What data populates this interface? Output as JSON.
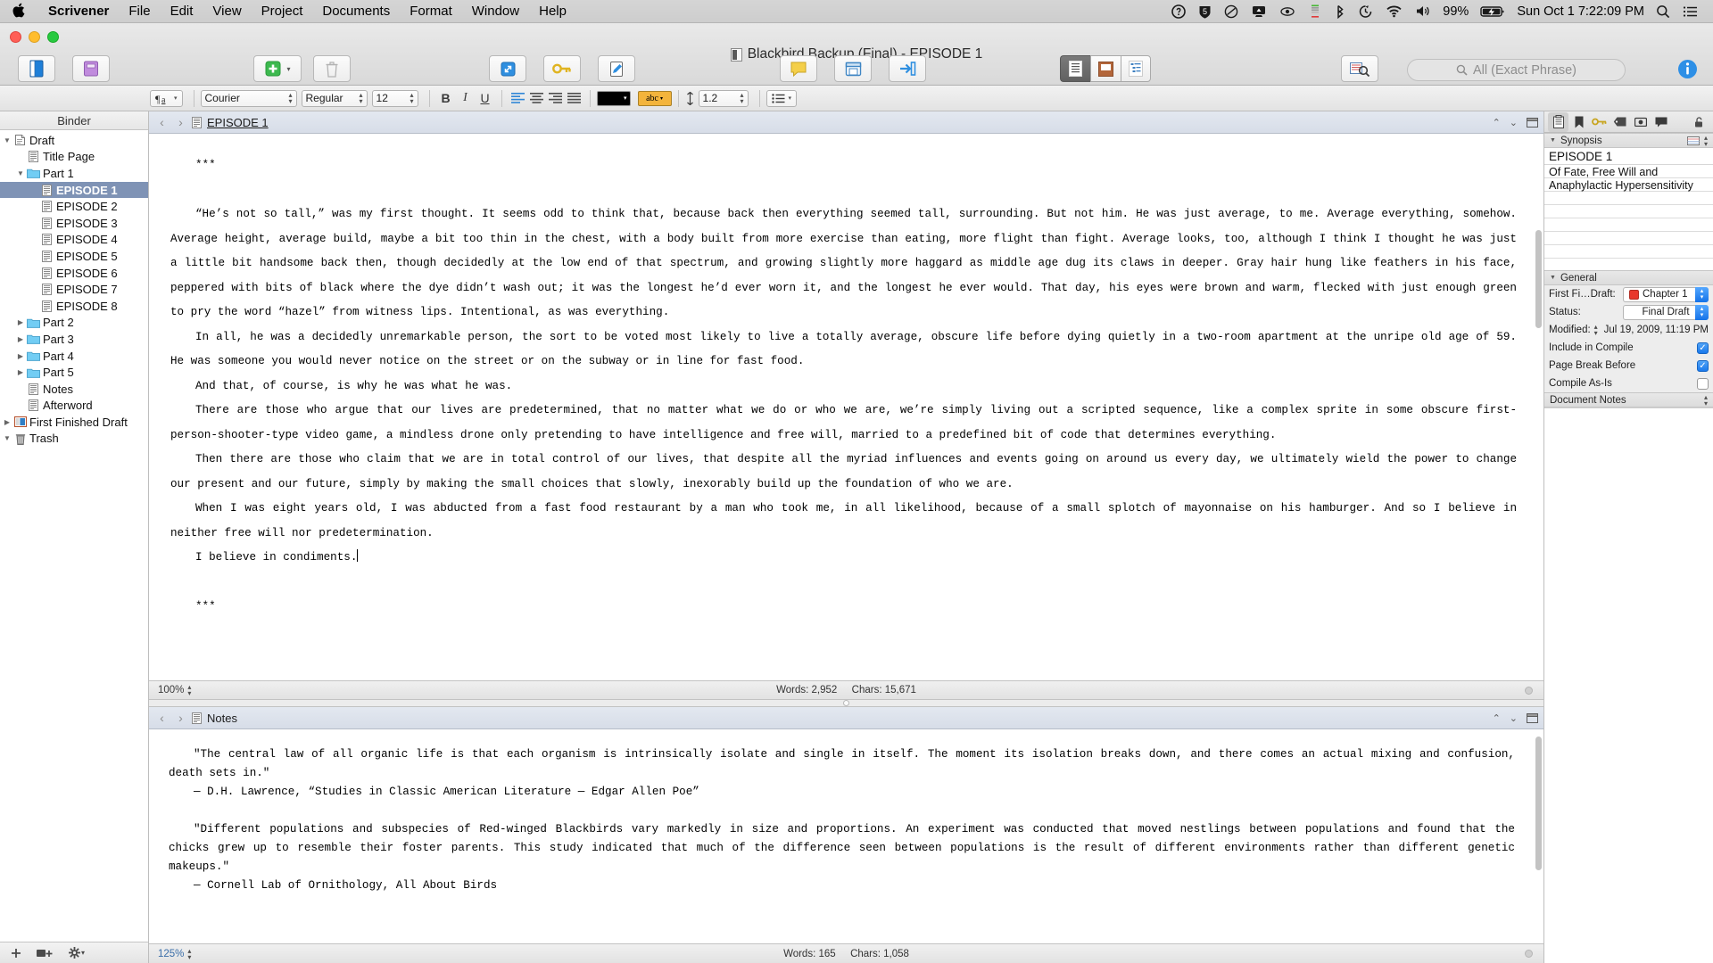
{
  "menubar": {
    "apple_icon": "apple-icon",
    "items": [
      {
        "label": "Scrivener",
        "bold": true
      },
      {
        "label": "File",
        "bold": false
      },
      {
        "label": "Edit",
        "bold": false
      },
      {
        "label": "View",
        "bold": false
      },
      {
        "label": "Project",
        "bold": false
      },
      {
        "label": "Documents",
        "bold": false
      },
      {
        "label": "Format",
        "bold": false
      },
      {
        "label": "Window",
        "bold": false
      },
      {
        "label": "Help",
        "bold": false
      }
    ],
    "status_icons": [
      "one-password-icon",
      "shield-icon",
      "crashplan-icon",
      "display-menu-icon",
      "eye-icon",
      "istat-menu-icon",
      "bluetooth-icon",
      "time-machine-icon",
      "wifi-icon",
      "volume-icon"
    ],
    "battery_percent": "99%",
    "battery_icon": "battery-charging-icon",
    "clock": "Sun Oct 1  7:22:09 PM",
    "search_icon": "spotlight-search-icon",
    "notification_icon": "notification-center-icon"
  },
  "window": {
    "title": "Blackbird Backup (Final) - EPISODE 1",
    "title_icon": "document-icon"
  },
  "toolbar": {
    "left_group": [
      {
        "label": "Binder",
        "icon": "binder-icon",
        "disabled": false
      },
      {
        "label": "Collections",
        "icon": "collections-icon",
        "disabled": false
      }
    ],
    "add_group": [
      {
        "label": "Add",
        "icon": "add-plus-icon",
        "disabled": false
      },
      {
        "label": "Trash",
        "icon": "trash-icon",
        "disabled": true
      }
    ],
    "tools_group": [
      {
        "label": "Compose",
        "icon": "compose-fullscreen-icon",
        "disabled": false
      },
      {
        "label": "Keywords",
        "icon": "keywords-key-icon",
        "disabled": false
      },
      {
        "label": "QuickRef",
        "icon": "quickref-pencil-icon",
        "disabled": false
      }
    ],
    "comment_group": [
      {
        "label": "Comment",
        "icon": "comment-bubble-icon",
        "disabled": false
      },
      {
        "label": "Wrap",
        "icon": "wrap-window-icon",
        "disabled": false
      },
      {
        "label": "Compile",
        "icon": "compile-arrow-icon",
        "disabled": false
      }
    ],
    "view_mode": {
      "label": "View Mode",
      "options": [
        "document-view-icon",
        "corkboard-view-icon",
        "outliner-view-icon"
      ],
      "selected_index": 0
    },
    "find_synopsis": {
      "label": "Find Synopsis",
      "icon": "find-synopsis-icon"
    },
    "search": {
      "label": "Search",
      "placeholder": "All (Exact Phrase)",
      "icon": "search-icon",
      "value": ""
    },
    "inspector": {
      "label": "Inspector",
      "icon": "info-circle-icon"
    }
  },
  "formatbar": {
    "paragraph_icon": "paragraph-style-icon",
    "font_family": "Courier",
    "font_style": "Regular",
    "font_size": "12",
    "bold": "B",
    "italic": "I",
    "underline": "U",
    "align_icons": [
      "align-left-icon",
      "align-center-icon",
      "align-right-icon",
      "align-justify-icon"
    ],
    "align_selected": 0,
    "text_color": "#000000",
    "highlight_color": "#f3b43c",
    "highlight_label": "abc",
    "line_spacing_icon": "line-spacing-icon",
    "line_spacing": "1.2",
    "list_icon": "list-icon"
  },
  "binder": {
    "header": "Binder",
    "items": [
      {
        "label": "Draft",
        "indent": 0,
        "icon": "draft-stack-icon",
        "disclosure": "down",
        "selected": false
      },
      {
        "label": "Title Page",
        "indent": 1,
        "icon": "text-doc-icon",
        "disclosure": "none",
        "selected": false
      },
      {
        "label": "Part 1",
        "indent": 1,
        "icon": "folder-icon",
        "disclosure": "down",
        "selected": false
      },
      {
        "label": "EPISODE 1",
        "indent": 2,
        "icon": "text-doc-icon",
        "disclosure": "none",
        "selected": true
      },
      {
        "label": "EPISODE 2",
        "indent": 2,
        "icon": "text-doc-icon",
        "disclosure": "none",
        "selected": false
      },
      {
        "label": "EPISODE 3",
        "indent": 2,
        "icon": "text-doc-icon",
        "disclosure": "none",
        "selected": false
      },
      {
        "label": "EPISODE 4",
        "indent": 2,
        "icon": "text-doc-icon",
        "disclosure": "none",
        "selected": false
      },
      {
        "label": "EPISODE 5",
        "indent": 2,
        "icon": "text-doc-icon",
        "disclosure": "none",
        "selected": false
      },
      {
        "label": "EPISODE 6",
        "indent": 2,
        "icon": "text-doc-icon",
        "disclosure": "none",
        "selected": false
      },
      {
        "label": "EPISODE 7",
        "indent": 2,
        "icon": "text-doc-icon",
        "disclosure": "none",
        "selected": false
      },
      {
        "label": "EPISODE 8",
        "indent": 2,
        "icon": "text-doc-icon",
        "disclosure": "none",
        "selected": false
      },
      {
        "label": "Part 2",
        "indent": 1,
        "icon": "folder-icon",
        "disclosure": "right",
        "selected": false
      },
      {
        "label": "Part 3",
        "indent": 1,
        "icon": "folder-icon",
        "disclosure": "right",
        "selected": false
      },
      {
        "label": "Part 4",
        "indent": 1,
        "icon": "folder-icon",
        "disclosure": "right",
        "selected": false
      },
      {
        "label": "Part 5",
        "indent": 1,
        "icon": "folder-icon",
        "disclosure": "right",
        "selected": false
      },
      {
        "label": "Notes",
        "indent": 1,
        "icon": "text-doc-icon",
        "disclosure": "none",
        "selected": false
      },
      {
        "label": "Afterword",
        "indent": 1,
        "icon": "text-doc-icon",
        "disclosure": "none",
        "selected": false
      },
      {
        "label": "First Finished Draft",
        "indent": 0,
        "icon": "snapshot-icon",
        "disclosure": "right",
        "selected": false
      },
      {
        "label": "Trash",
        "indent": 0,
        "icon": "trash-bin-icon",
        "disclosure": "down",
        "selected": false
      }
    ],
    "footer_icons": [
      "add-item-icon",
      "add-folder-icon",
      "settings-gear-icon"
    ]
  },
  "editor": {
    "back_icon": "back-chevron-icon",
    "forward_icon": "forward-chevron-icon",
    "doc_icon": "text-doc-icon",
    "title": "EPISODE 1",
    "header_right_icons": [
      "collapse-up-icon",
      "expand-down-icon",
      "split-editor-icon"
    ],
    "paragraphs": [
      {
        "text": "***",
        "type": "divider"
      },
      {
        "text": "",
        "type": "blank"
      },
      {
        "text": "“He’s not so tall,” was my first thought. It seems odd to think that, because back then everything seemed tall, surrounding. But not him. He was just average, to me. Average everything, somehow. Average height, average build, maybe a bit too thin in the chest, with a body built from more exercise than eating, more flight than fight. Average looks, too, although I think I thought he was just a little bit handsome back then, though decidedly at the low end of that spectrum, and growing slightly more haggard as middle age dug its claws in deeper. Gray hair hung like feathers in his face, peppered with bits of black where the dye didn’t wash out; it was the longest he’d ever worn it, and the longest he ever would. That day, his eyes were brown and warm, flecked with just enough green to pry the word “hazel” from witness lips. Intentional, as was everything.",
        "type": "body"
      },
      {
        "text": "In all, he was a decidedly unremarkable person, the sort to be voted most likely to live a totally average, obscure life before dying quietly in a two-room apartment at the unripe old age of 59. He was someone you would never notice on the street or on the subway or in line for fast food.",
        "type": "body"
      },
      {
        "text": "And that, of course, is why he was what he was.",
        "type": "body"
      },
      {
        "text": "There are those who argue that our lives are predetermined, that no matter what we do or who we are, we’re simply living out a scripted sequence, like a complex sprite in some obscure first-person-shooter-type video game, a mindless drone only pretending to have intelligence and free will, married to a predefined bit of code that determines everything.",
        "type": "body"
      },
      {
        "text": "Then there are those who claim that we are in total control of our lives, that despite all the myriad influences and events going on around us every day, we ultimately wield the power to change our present and our future, simply by making the small choices that slowly, inexorably build up the foundation of who we are.",
        "type": "body"
      },
      {
        "text": "When I was eight years old, I was abducted from a fast food restaurant by a man who took me, in all likelihood, because of a small splotch of mayonnaise on his hamburger. And so I believe in neither free will nor predetermination.",
        "type": "body"
      },
      {
        "text": "I believe in condiments.",
        "type": "body-caret"
      },
      {
        "text": "",
        "type": "blank"
      },
      {
        "text": "***",
        "type": "divider"
      }
    ],
    "footer": {
      "zoom": "100%",
      "words_label": "Words: 2,952",
      "chars_label": "Chars: 15,671"
    }
  },
  "notes": {
    "back_icon": "back-chevron-icon",
    "forward_icon": "forward-chevron-icon",
    "doc_icon": "text-doc-icon",
    "title": "Notes",
    "header_right_icons": [
      "collapse-up-icon",
      "expand-down-icon",
      "split-editor-icon"
    ],
    "paragraphs": [
      {
        "text": "\"The central law of all organic life is that each organism is intrinsically isolate and single in itself. The moment its isolation breaks down, and there comes an actual mixing and confusion, death sets in.\"",
        "type": "quote"
      },
      {
        "text": "— D.H. Lawrence, “Studies in Classic American Literature — Edgar Allen Poe”",
        "type": "attrib"
      },
      {
        "text": "",
        "type": "blank"
      },
      {
        "text": "\"Different populations and subspecies of Red-winged Blackbirds vary markedly in size and proportions. An experiment was conducted that moved nestlings between populations and found that the chicks grew up to resemble their foster parents. This study indicated that much of the difference seen between populations is the result of different environments rather than different genetic makeups.\"",
        "type": "quote"
      },
      {
        "text": "— Cornell Lab of Ornithology, All About Birds",
        "type": "attrib"
      }
    ],
    "footer": {
      "zoom": "125%",
      "words_label": "Words: 165",
      "chars_label": "Chars: 1,058"
    }
  },
  "inspector": {
    "tabs": [
      "notes-pad-icon",
      "bookmark-icon",
      "keywords-key-icon",
      "label-tag-icon",
      "snapshot-camera-icon",
      "comments-bubble-icon"
    ],
    "active_tab_index": 0,
    "lock_icon": "unlock-icon",
    "synopsis": {
      "section_label": "Synopsis",
      "card_icon": "index-card-icon",
      "stepper_icon": "stepper-icon",
      "title": "EPISODE 1",
      "body": "Of Fate, Free Will and Anaphylactic Hypersensitivity"
    },
    "general": {
      "section_label": "General",
      "label_row": {
        "label": "First Fi…Draft:",
        "value": "Chapter 1",
        "swatch_color": "#e8372c"
      },
      "status_row": {
        "label": "Status:",
        "value": "Final Draft"
      },
      "modified_row": {
        "label": "Modified:",
        "value": "Jul 19, 2009, 11:19 PM"
      },
      "checkboxes": [
        {
          "label": "Include in Compile",
          "checked": true
        },
        {
          "label": "Page Break Before",
          "checked": true
        },
        {
          "label": "Compile As-Is",
          "checked": false
        }
      ]
    },
    "document_notes": {
      "section_label": "Document Notes"
    }
  }
}
